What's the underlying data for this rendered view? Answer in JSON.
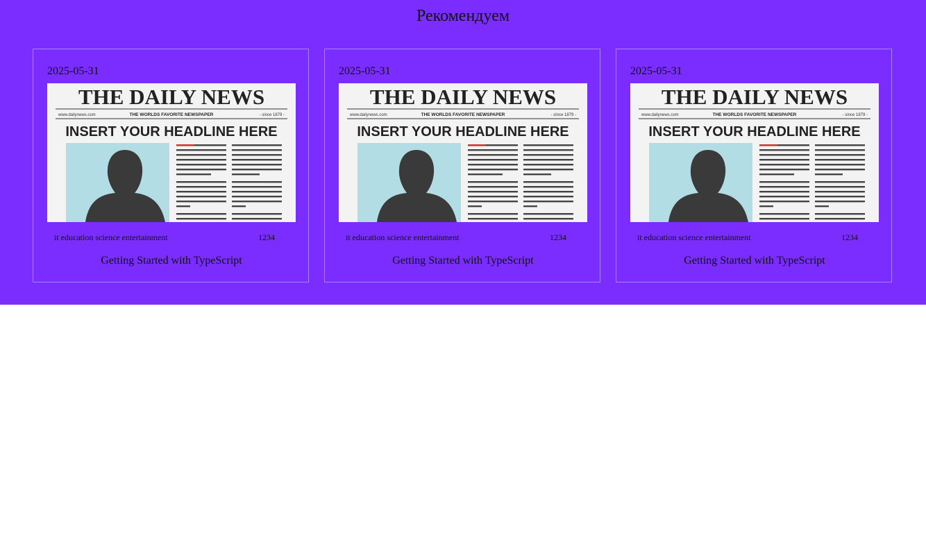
{
  "section": {
    "title": "Рекомендуем"
  },
  "colors": {
    "background": "#7b2cff",
    "card_border": "#a784ff",
    "text": "#111111"
  },
  "cards": [
    {
      "date": "2025-05-31",
      "tags": "it education science entertainment",
      "views": "1234",
      "title": "Getting Started with TypeScript",
      "image": {
        "masthead": "THE DAILY NEWS",
        "site": "www.dailynews.com",
        "tagline": "THE WORLDS FAVORITE NEWSPAPER",
        "since": "- since 1879 -",
        "headline": "INSERT YOUR HEADLINE HERE"
      }
    },
    {
      "date": "2025-05-31",
      "tags": "it education science entertainment",
      "views": "1234",
      "title": "Getting Started with TypeScript",
      "image": {
        "masthead": "THE DAILY NEWS",
        "site": "www.dailynews.com",
        "tagline": "THE WORLDS FAVORITE NEWSPAPER",
        "since": "- since 1879 -",
        "headline": "INSERT YOUR HEADLINE HERE"
      }
    },
    {
      "date": "2025-05-31",
      "tags": "it education science entertainment",
      "views": "1234",
      "title": "Getting Started with TypeScript",
      "image": {
        "masthead": "THE DAILY NEWS",
        "site": "www.dailynews.com",
        "tagline": "THE WORLDS FAVORITE NEWSPAPER",
        "since": "- since 1879 -",
        "headline": "INSERT YOUR HEADLINE HERE"
      }
    }
  ]
}
